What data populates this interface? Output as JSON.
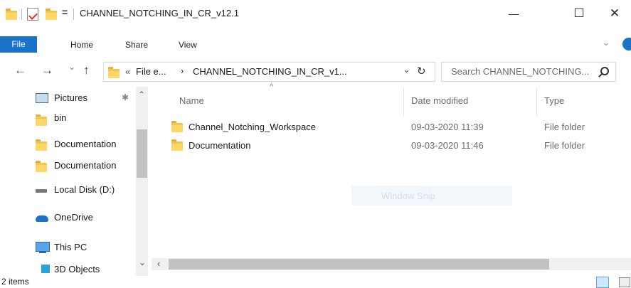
{
  "window": {
    "title": "CHANNEL_NOTCHING_IN_CR_v12.1",
    "qat_dropdown": "=",
    "controls": {
      "minimize": "—",
      "maximize": "☐",
      "close": "✕"
    }
  },
  "ribbon": {
    "tabs": [
      {
        "label": "File"
      },
      {
        "label": "Home"
      },
      {
        "label": "Share"
      },
      {
        "label": "View"
      }
    ],
    "expand_glyph": "⌄"
  },
  "address_bar": {
    "back": "←",
    "forward": "→",
    "recent": "⌄",
    "up": "↑",
    "path_prefix": "«",
    "crumb_1": "File e...",
    "separator": "›",
    "crumb_2": "CHANNEL_NOTCHING_IN_CR_v1...",
    "dropdown": "⌄",
    "refresh": "↻"
  },
  "search": {
    "placeholder": "Search CHANNEL_NOTCHING..."
  },
  "nav_pane": {
    "items": [
      {
        "label": "Pictures",
        "icon": "pictures-icon",
        "pinned": true
      },
      {
        "label": "bin",
        "icon": "folder-icon"
      },
      {
        "label": "Documentation",
        "icon": "folder-icon"
      },
      {
        "label": "Documentation",
        "icon": "folder-icon"
      },
      {
        "label": "Local Disk (D:)",
        "icon": "drive-icon"
      },
      {
        "label": "OneDrive",
        "icon": "onedrive-icon"
      },
      {
        "label": "This PC",
        "icon": "pc-icon"
      },
      {
        "label": "3D Objects",
        "icon": "3d-objects-icon"
      }
    ]
  },
  "file_list": {
    "columns": [
      {
        "label": "Name"
      },
      {
        "label": "Date modified"
      },
      {
        "label": "Type"
      }
    ],
    "rows": [
      {
        "name": "Channel_Notching_Workspace",
        "date": "09-03-2020 11:39",
        "type": "File folder"
      },
      {
        "name": "Documentation",
        "date": "09-03-2020 11:46",
        "type": "File folder"
      }
    ]
  },
  "overlay": {
    "label": "Window Snip"
  },
  "status_bar": {
    "item_count": "2 items"
  },
  "colors": {
    "accent": "#1a73c9",
    "folder": "#ffd766",
    "selection": "#cce8ff"
  }
}
